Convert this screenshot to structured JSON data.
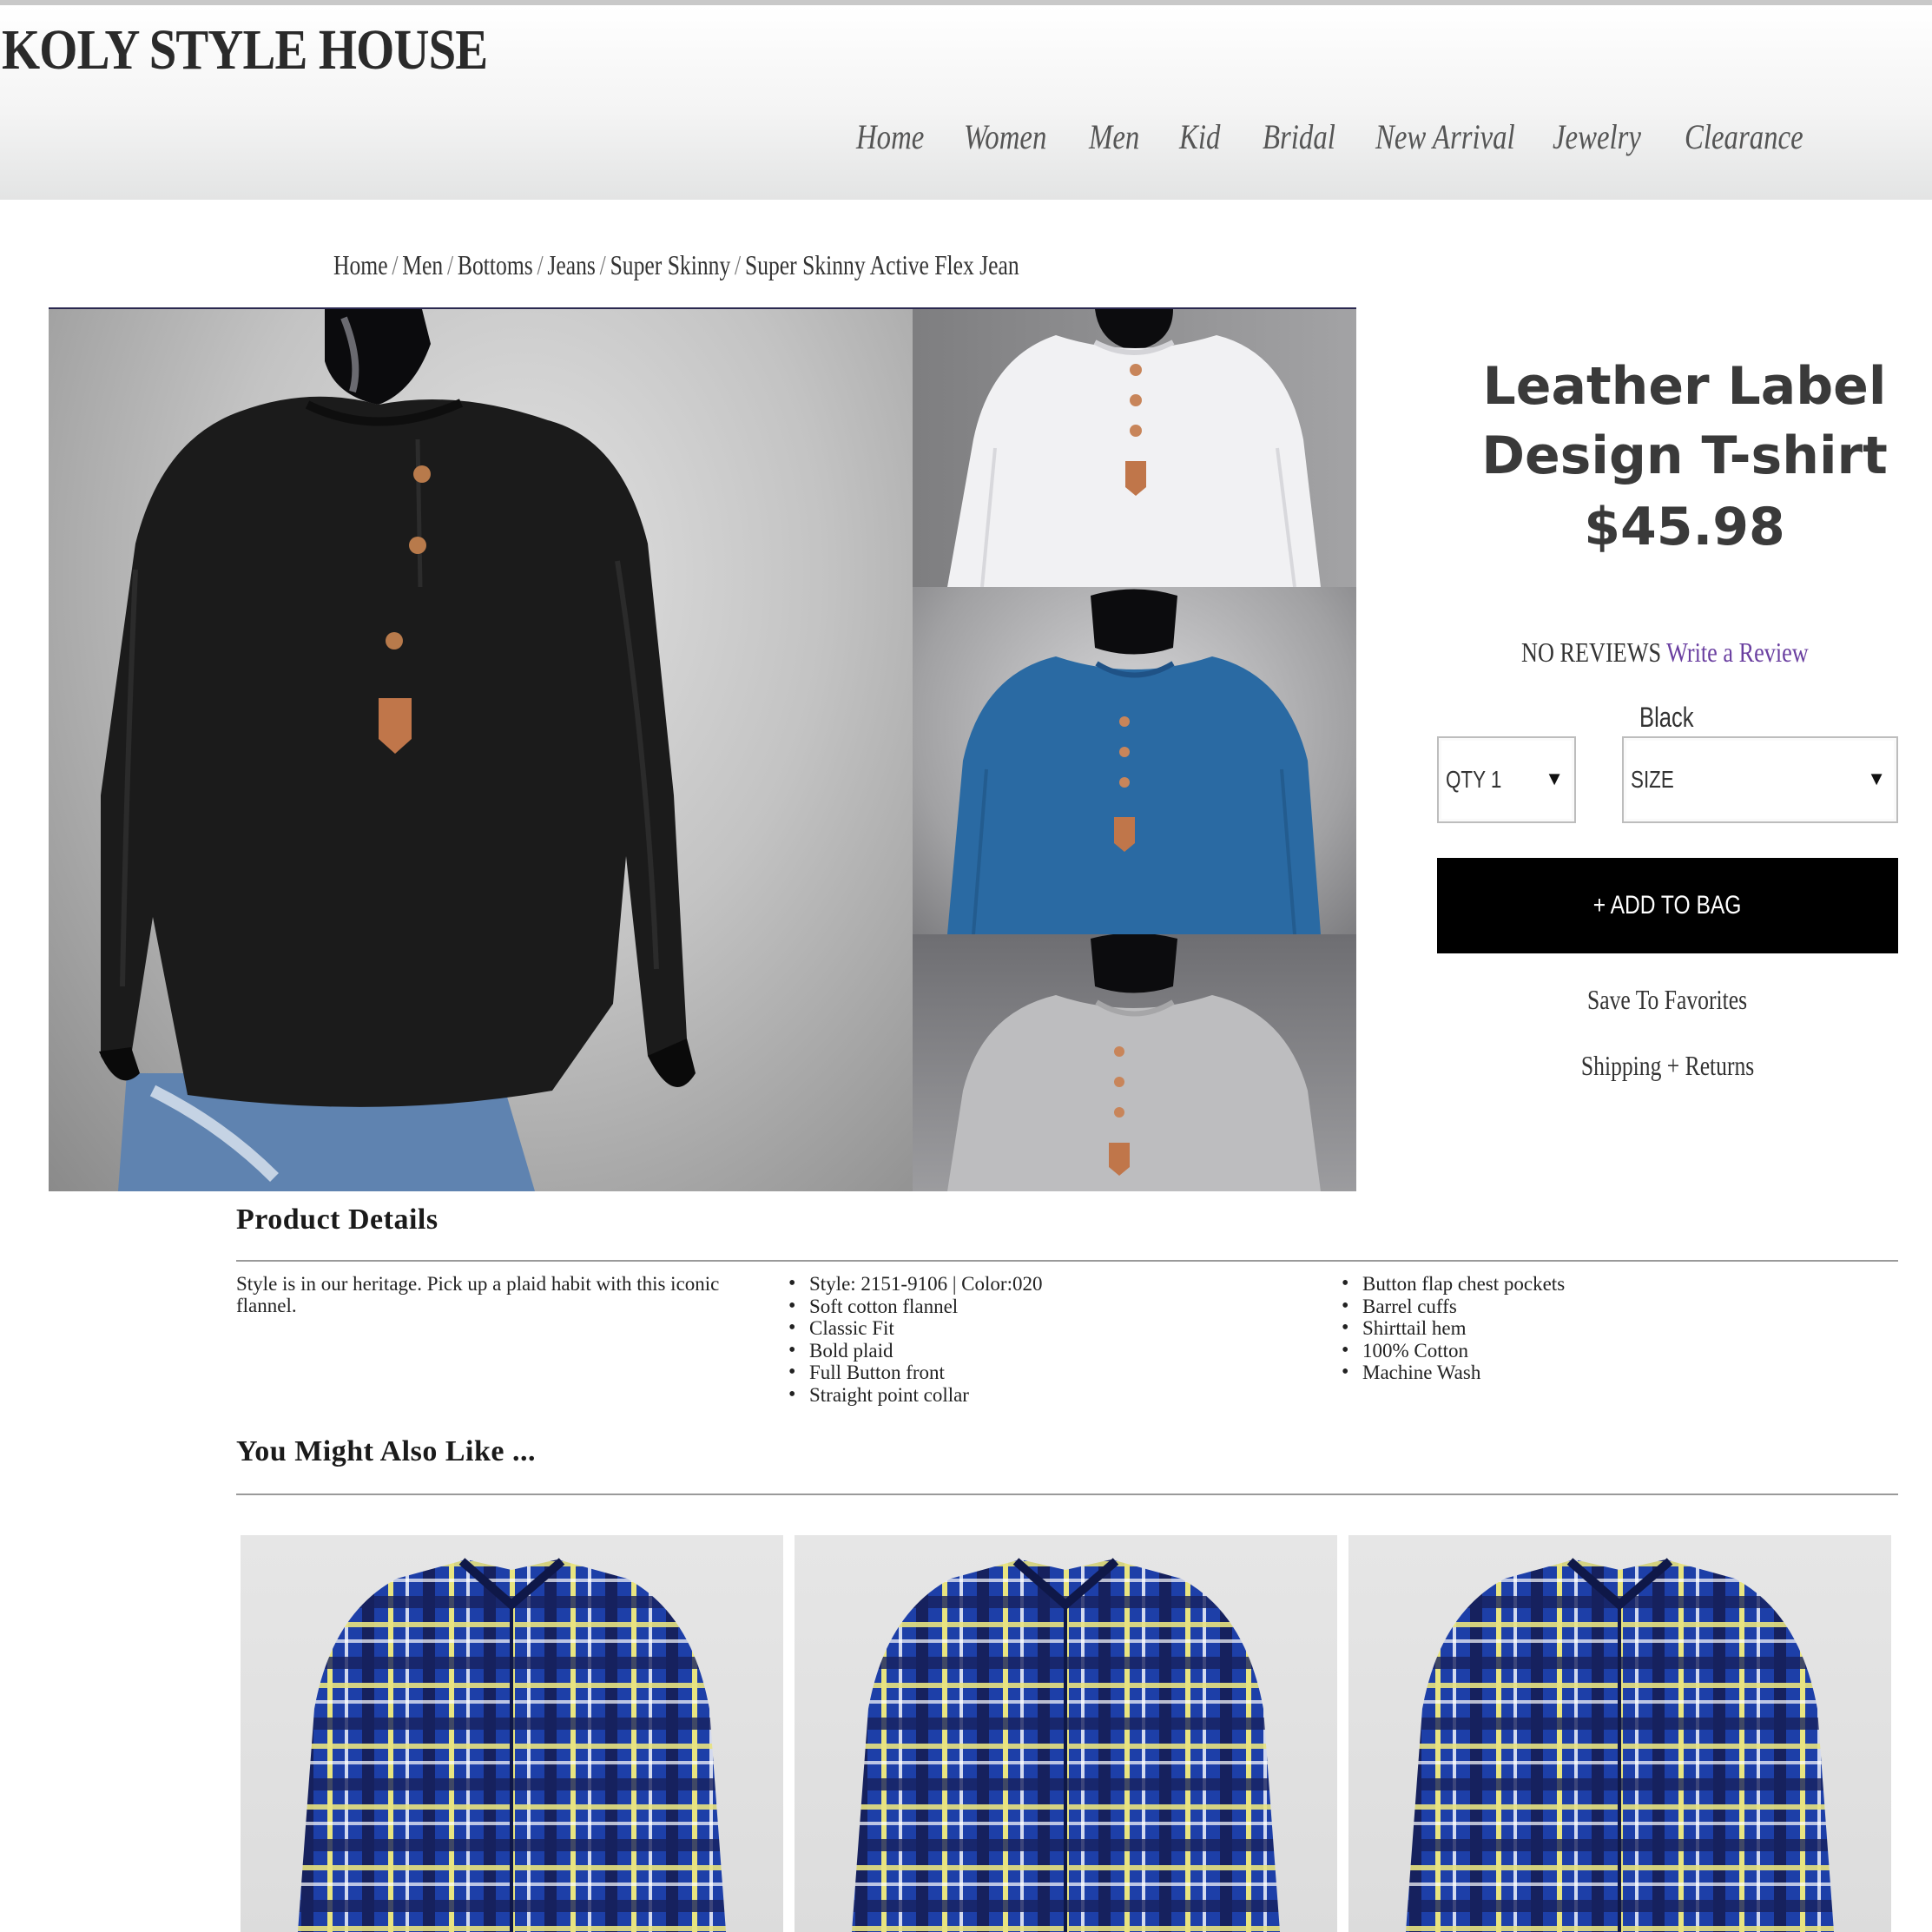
{
  "site": {
    "brand": "KOLY STYLE HOUSE"
  },
  "nav": {
    "items": [
      "Home",
      "Women",
      "Men",
      "Kid",
      "Bridal",
      "New Arrival",
      "Jewelry",
      "Clearance"
    ]
  },
  "breadcrumb": {
    "items": [
      "Home",
      "Men",
      "Bottoms",
      "Jeans",
      "Super Skinny",
      "Super Skinny Active Flex Jean"
    ],
    "separator": "/"
  },
  "product": {
    "title_line1": "Leather Label",
    "title_line2": "Design T-shirt",
    "price": "$45.98",
    "reviews_label": "NO REVIEWS",
    "write_review": "Write a Review",
    "color": "Black",
    "qty_label": "QTY 1",
    "size_label": "SIZE",
    "add_to_bag": "+ ADD TO BAG",
    "save_favorites": "Save To Favorites",
    "shipping_returns": "Shipping + Returns",
    "gallery": {
      "main_color": "black",
      "thumbnails": [
        "white",
        "blue",
        "grey"
      ]
    }
  },
  "details": {
    "heading": "Product Details",
    "description": "Style is in our heritage. Pick up a plaid habit with this iconic flannel.",
    "features_col1": [
      "Style: 2151-9106 | Color:020",
      "Soft cotton flannel",
      "Classic Fit",
      "Bold plaid",
      "Full Button front",
      "Straight point collar"
    ],
    "features_col2": [
      "Button flap chest pockets",
      "Barrel cuffs",
      "Shirttail hem",
      "100% Cotton",
      "Machine Wash"
    ]
  },
  "recommendations": {
    "heading": "You Might Also Like ...",
    "items": [
      "blue plaid flannel shirt",
      "blue plaid flannel shirt",
      "blue plaid flannel shirt"
    ]
  },
  "colors": {
    "accent_link": "#6a3fa0",
    "button_bg": "#000000",
    "button_text": "#ffffff",
    "shirt_black": "#1b1b1b",
    "shirt_white": "#f1f1f3",
    "shirt_blue": "#2a6aa3",
    "shirt_grey": "#bdbdbf",
    "plaid_blue": "#1d3fa8",
    "plaid_yellow": "#e8e480"
  }
}
